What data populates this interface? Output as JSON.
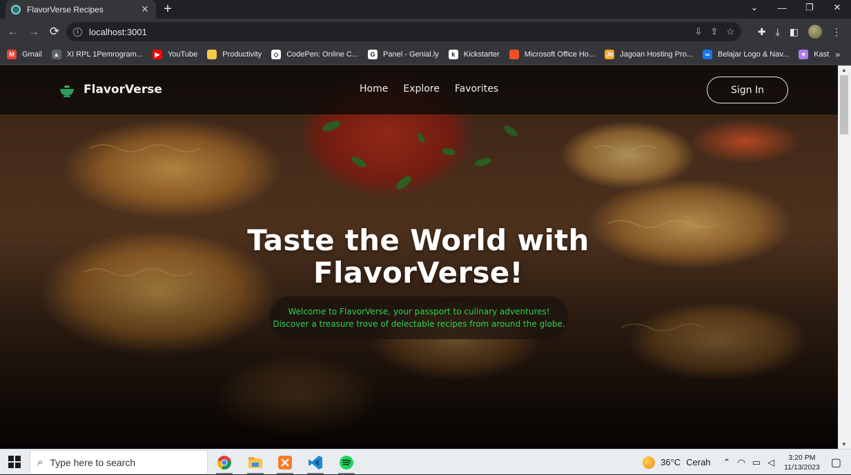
{
  "browser": {
    "tab_title": "FlavorVerse Recipes",
    "tab_close": "✕",
    "new_tab": "+",
    "url": "localhost:3001",
    "window_controls": {
      "list": "⌄",
      "minimize": "—",
      "restore": "❐",
      "close": "✕"
    }
  },
  "bookmarks": [
    {
      "label": "Gmail",
      "icon": "gmail-icon",
      "color": "#ea4335",
      "glyph": "M"
    },
    {
      "label": "XI RPL 1Pemrogram...",
      "icon": "classroom-icon",
      "color": "#5f6368",
      "glyph": "▲"
    },
    {
      "label": "YouTube",
      "icon": "youtube-icon",
      "color": "#ff0000",
      "glyph": "▶"
    },
    {
      "label": "Productivity",
      "icon": "folder-icon",
      "color": "#f6c94b",
      "glyph": ""
    },
    {
      "label": "CodePen: Online C...",
      "icon": "codepen-icon",
      "color": "#ffffff",
      "glyph": "◇"
    },
    {
      "label": "Panel - Genial.ly",
      "icon": "genially-icon",
      "color": "#ffffff",
      "glyph": "G"
    },
    {
      "label": "Kickstarter",
      "icon": "kickstarter-icon",
      "color": "#ffffff",
      "glyph": "k"
    },
    {
      "label": "Microsoft Office Ho...",
      "icon": "office-icon",
      "color": "#f25022",
      "glyph": ""
    },
    {
      "label": "Jagoan Hosting Pro...",
      "icon": "jagoanhosting-icon",
      "color": "#f5a623",
      "glyph": "Jh"
    },
    {
      "label": "Belajar Logo & Nav...",
      "icon": "meta-icon",
      "color": "#1877f2",
      "glyph": "∞"
    },
    {
      "label": "Kast",
      "icon": "kast-icon",
      "color": "#b07cf0",
      "glyph": "♥"
    }
  ],
  "bookmarks_more": "»",
  "site": {
    "brand": "FlavorVerse",
    "nav": [
      "Home",
      "Explore",
      "Favorites"
    ],
    "signin": "Sign In",
    "hero_title_line1": "Taste the World with",
    "hero_title_line2": "FlavorVerse!",
    "hero_sub_line1": "Welcome to FlavorVerse, your passport to culinary adventures!",
    "hero_sub_line2": "Discover a treasure trove of delectable recipes from around the globe.",
    "accent_color": "#2fd152"
  },
  "taskbar": {
    "search_placeholder": "Type here to search",
    "apps": [
      "chrome-icon",
      "file-explorer-icon",
      "xampp-icon",
      "vscode-icon",
      "spotify-icon"
    ],
    "weather_temp": "36°C",
    "weather_cond": "Cerah",
    "time": "3:20 PM",
    "date": "11/13/2023"
  }
}
